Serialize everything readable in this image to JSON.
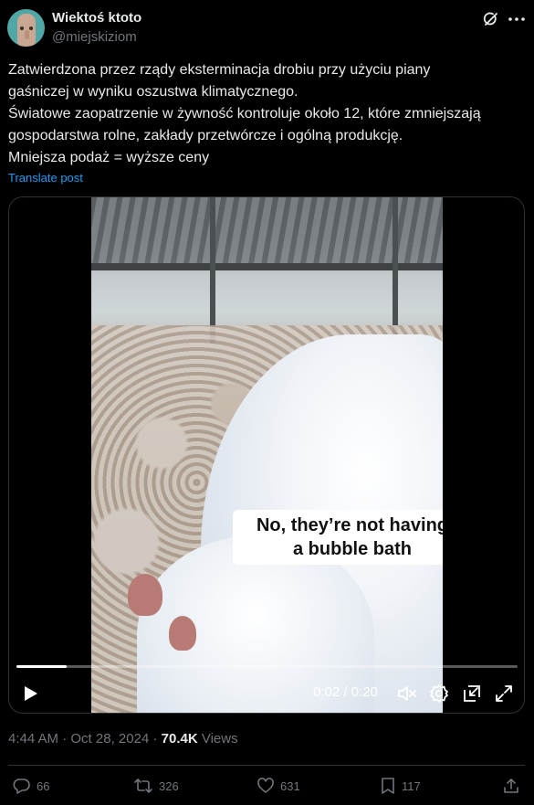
{
  "author": {
    "name": "Wiektoś ktoto",
    "handle": "@miejskiziom"
  },
  "post": {
    "lines": [
      "Zatwierdzona przez rządy eksterminacja drobiu przy użyciu piany",
      "gaśniczej w wyniku oszustwa klimatycznego.",
      "Światowe zaopatrzenie w żywność kontroluje około 12, które zmniejszają",
      "gospodarstwa rolne, zakłady przetwórcze i ogólną produkcję.",
      "Mniejsza podaż = wyższe ceny"
    ],
    "translate_label": "Translate post"
  },
  "video": {
    "caption_line1": "No, they’re not having",
    "caption_line2": "a bubble bath",
    "time": "0:02 / 0:20",
    "progress_fraction": 0.1
  },
  "meta": {
    "time": "4:44 AM",
    "separator": " · ",
    "date": "Oct 28, 2024",
    "views_count": "70.4K",
    "views_label": "Views"
  },
  "actions": {
    "replies": "66",
    "reposts": "326",
    "likes": "631",
    "bookmarks": "117"
  },
  "icons": [
    "grok-icon",
    "more-icon",
    "play-icon",
    "mute-icon",
    "settings-icon",
    "pip-icon",
    "fullscreen-icon",
    "reply-icon",
    "repost-icon",
    "like-icon",
    "bookmark-icon",
    "share-icon"
  ],
  "colors": {
    "background": "#000000",
    "text": "#e7e9ea",
    "muted": "#71767b",
    "link": "#1d9bf0",
    "border": "#2f3336"
  }
}
